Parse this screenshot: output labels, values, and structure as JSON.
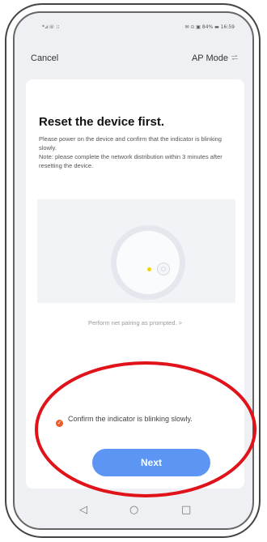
{
  "status_bar": {
    "left": "*⊿☏ ⁝⁝",
    "right": "✉ ⊙ ▣ 84% ▬ 16:59"
  },
  "header": {
    "cancel_label": "Cancel",
    "mode_label": "AP Mode",
    "mode_icon": "switch-icon"
  },
  "content": {
    "title": "Reset the device first.",
    "description": "Please power on the device and confirm that the indicator is blinking slowly.\nNote: please complete the network distribution within 3 minutes after resetting the device.",
    "prompt_link": "Perform net pairing as prompted. >",
    "confirm_label": "Confirm the indicator is blinking slowly.",
    "checkbox_checked": true,
    "next_label": "Next"
  },
  "nav_bar": {
    "back_icon": "◁",
    "home_icon": "○",
    "recent_icon": "□"
  },
  "colors": {
    "accent": "#5d95f5",
    "checkbox": "#f05a28",
    "annotation": "#e0131b",
    "indicator": "#f5d20a"
  }
}
